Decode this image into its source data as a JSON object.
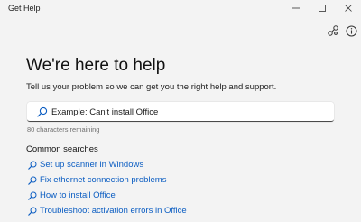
{
  "window": {
    "title": "Get Help",
    "controls": [
      {
        "name": "minimize-button",
        "icon": "minimize-icon",
        "class": "min"
      },
      {
        "name": "maximize-button",
        "icon": "maximize-icon",
        "class": "max"
      },
      {
        "name": "close-button",
        "icon": "close-icon",
        "class": "close"
      }
    ]
  },
  "toolbar": {
    "icons": [
      "share-icon",
      "info-icon"
    ]
  },
  "main": {
    "heading": "We're here to help",
    "subheading": "Tell us your problem so we can get you the right help and support.",
    "search": {
      "placeholder": "Example: Can't install Office",
      "value": "",
      "chars_remaining": "80 characters remaining"
    },
    "common_searches": {
      "title": "Common searches",
      "items": [
        "Set up scanner in Windows",
        "Fix ethernet connection problems",
        "How to install Office",
        "Troubleshoot activation errors in Office"
      ]
    }
  },
  "colors": {
    "background": "#f3f3f3",
    "link": "#0b5dc2",
    "text": "#1a1a1a"
  }
}
